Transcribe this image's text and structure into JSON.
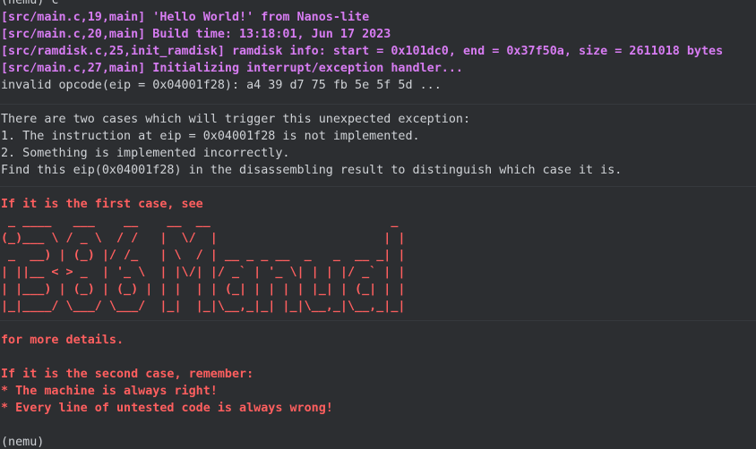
{
  "terminal": {
    "lines": [
      {
        "kind": "prompt",
        "text": "(nemu) c"
      },
      {
        "kind": "log",
        "text": "[src/main.c,19,main] 'Hello World!' from Nanos-lite"
      },
      {
        "kind": "log",
        "text": "[src/main.c,20,main] Build time: 13:18:01, Jun 17 2023"
      },
      {
        "kind": "log",
        "text": "[src/ramdisk.c,25,init_ramdisk] ramdisk info: start = 0x101dc0, end = 0x37f50a, size = 2611018 bytes"
      },
      {
        "kind": "log",
        "text": "[src/main.c,27,main] Initializing interrupt/exception handler..."
      },
      {
        "kind": "plain",
        "text": "invalid opcode(eip = 0x04001f28): a4 39 d7 75 fb 5e 5f 5d ..."
      },
      {
        "kind": "plain",
        "text": ""
      },
      {
        "kind": "plain",
        "text": "There are two cases which will trigger this unexpected exception:"
      },
      {
        "kind": "plain",
        "text": "1. The instruction at eip = 0x04001f28 is not implemented."
      },
      {
        "kind": "plain",
        "text": "2. Something is implemented incorrectly."
      },
      {
        "kind": "plain",
        "text": "Find this eip(0x04001f28) in the disassembling result to distinguish which case it is."
      },
      {
        "kind": "plain",
        "text": ""
      },
      {
        "kind": "err",
        "text": "If it is the first case, see"
      },
      {
        "kind": "art",
        "text": " _ ____   ___    __    __  __                         _ "
      },
      {
        "kind": "art",
        "text": "(_)___ \\ / _ \\  / /   |  \\/  |                       | |"
      },
      {
        "kind": "art",
        "text": " _  __) | (_) |/ /_   | \\  / | __ _ _ __  _   _  __ _| |"
      },
      {
        "kind": "art",
        "text": "| ||__ < > _  | '_ \\  | |\\/| |/ _` | '_ \\| | | |/ _` | |"
      },
      {
        "kind": "art",
        "text": "| |___) | (_) | (_) | | |  | | (_| | | | | |_| | (_| | |"
      },
      {
        "kind": "art",
        "text": "|_|____/ \\___/ \\___/  |_|  |_|\\__,_|_| |_|\\__,_|\\__,_|_|"
      },
      {
        "kind": "plain",
        "text": ""
      },
      {
        "kind": "err",
        "text": "for more details."
      },
      {
        "kind": "plain",
        "text": ""
      },
      {
        "kind": "err",
        "text": "If it is the second case, remember:"
      },
      {
        "kind": "err",
        "text": "* The machine is always right!"
      },
      {
        "kind": "err",
        "text": "* Every line of untested code is always wrong!"
      },
      {
        "kind": "plain",
        "text": ""
      },
      {
        "kind": "prompt",
        "text": "(nemu)"
      }
    ]
  }
}
